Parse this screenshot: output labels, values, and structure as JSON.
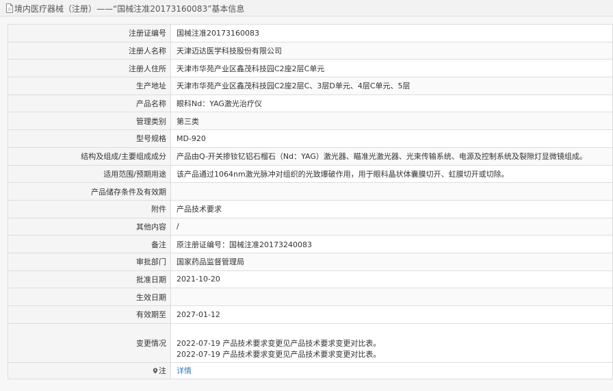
{
  "header": {
    "title": "境内医疗器械（注册）——“国械注准20173160083”基本信息"
  },
  "rows": [
    {
      "label": "注册证编号",
      "value": "国械注准20173160083"
    },
    {
      "label": "注册人名称",
      "value": "天津迈达医学科技股份有限公司"
    },
    {
      "label": "注册人住所",
      "value": "天津市华苑产业区鑫茂科技园C2座2层C单元"
    },
    {
      "label": "生产地址",
      "value": "天津市华苑产业区鑫茂科技园C2座2层C、3层D单元、4层C单元、5层"
    },
    {
      "label": "产品名称",
      "value": "眼科Nd：YAG激光治疗仪"
    },
    {
      "label": "管理类别",
      "value": "第三类"
    },
    {
      "label": "型号规格",
      "value": "MD-920"
    },
    {
      "label": "结构及组成/主要组成成分",
      "value": "产品由Q-开关掺钕钇铝石榴石（Nd：YAG）激光器、瞄准光激光器、光束传输系统、电源及控制系统及裂隙灯显微镜组成。"
    },
    {
      "label": "适用范围/预期用途",
      "value": "该产品通过1064nm激光脉冲对组织的光致爆破作用，用于眼科晶状体囊膜切开、虹膜切开或切除。"
    },
    {
      "label": "产品储存条件及有效期",
      "value": ""
    },
    {
      "label": "附件",
      "value": "产品技术要求"
    },
    {
      "label": "其他内容",
      "value": "/"
    },
    {
      "label": "备注",
      "value": "原注册证编号：国械注准20173240083"
    },
    {
      "label": "审批部门",
      "value": "国家药品监督管理局"
    },
    {
      "label": "批准日期",
      "value": "2021-10-20"
    },
    {
      "label": "生效日期",
      "value": ""
    },
    {
      "label": "有效期至",
      "value": "2027-01-12"
    }
  ],
  "changes": {
    "label": "变更情况",
    "lines": [
      "2022-07-19 产品技术要求变更见产品技术要求变更对比表。",
      "2022-07-19 产品技术要求变更见产品技术要求变更对比表。"
    ]
  },
  "note": {
    "label": "注",
    "icon": "pin-icon",
    "link_text": "详情"
  }
}
